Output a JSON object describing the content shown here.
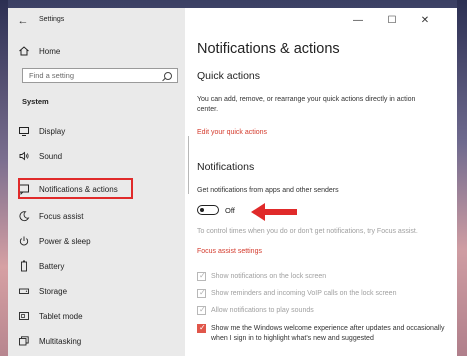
{
  "window": {
    "title": "Settings"
  },
  "titlebar_buttons": {
    "minimize": "—",
    "maximize": "☐",
    "close": "✕"
  },
  "sidebar": {
    "home": "Home",
    "search_placeholder": "Find a setting",
    "section": "System",
    "items": [
      {
        "label": "Display",
        "icon": "display-icon"
      },
      {
        "label": "Sound",
        "icon": "sound-icon"
      },
      {
        "label": "Notifications & actions",
        "icon": "notifications-icon",
        "selected": true
      },
      {
        "label": "Focus assist",
        "icon": "moon-icon"
      },
      {
        "label": "Power & sleep",
        "icon": "power-icon"
      },
      {
        "label": "Battery",
        "icon": "battery-icon"
      },
      {
        "label": "Storage",
        "icon": "storage-icon"
      },
      {
        "label": "Tablet mode",
        "icon": "tablet-icon"
      },
      {
        "label": "Multitasking",
        "icon": "multitasking-icon"
      }
    ]
  },
  "main": {
    "title": "Notifications & actions",
    "quick_actions": {
      "heading": "Quick actions",
      "description": "You can add, remove, or rearrange your quick actions directly in action center.",
      "link": "Edit your quick actions"
    },
    "notifications": {
      "heading": "Notifications",
      "toggle_label": "Get notifications from apps and other senders",
      "toggle_state": "Off",
      "toggle_on": false,
      "focus_text": "To control times when you do or don't get notifications, try Focus assist.",
      "focus_link": "Focus assist settings",
      "options": [
        {
          "label": "Show notifications on the lock screen",
          "checked": true,
          "enabled": false
        },
        {
          "label": "Show reminders and incoming VoIP calls on the lock screen",
          "checked": true,
          "enabled": false
        },
        {
          "label": "Allow notifications to play sounds",
          "checked": true,
          "enabled": false
        },
        {
          "label": "Show me the Windows welcome experience after updates and occasionally when I sign in to highlight what's new and suggested",
          "checked": true,
          "enabled": true
        }
      ]
    }
  },
  "colors": {
    "accent": "#d43a2c",
    "annotation": "#e02a2a"
  }
}
